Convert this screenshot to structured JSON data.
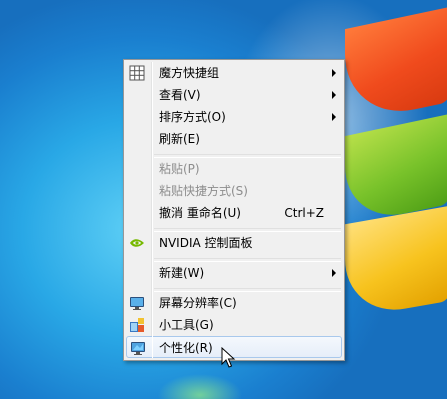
{
  "context_menu": {
    "items": [
      {
        "label": "魔方快捷组",
        "submenu": true,
        "icon": "grid-icon"
      },
      {
        "label": "查看(V)",
        "submenu": true
      },
      {
        "label": "排序方式(O)",
        "submenu": true
      },
      {
        "label": "刷新(E)"
      },
      {
        "label": "粘贴(P)",
        "disabled": true
      },
      {
        "label": "粘贴快捷方式(S)",
        "disabled": true
      },
      {
        "label": "撤消 重命名(U)",
        "shortcut": "Ctrl+Z"
      },
      {
        "label": "NVIDIA 控制面板",
        "icon": "nvidia-icon"
      },
      {
        "label": "新建(W)",
        "submenu": true
      },
      {
        "label": "屏幕分辨率(C)",
        "icon": "monitor-icon"
      },
      {
        "label": "小工具(G)",
        "icon": "gadgets-icon"
      },
      {
        "label": "个性化(R)",
        "icon": "personalize-icon",
        "highlighted": true
      }
    ]
  },
  "colors": {
    "menu_background": "#f0f0f0",
    "highlight_border": "#a8c8ec",
    "disabled_text": "#8d8d8d",
    "nvidia_green": "#76b900"
  }
}
